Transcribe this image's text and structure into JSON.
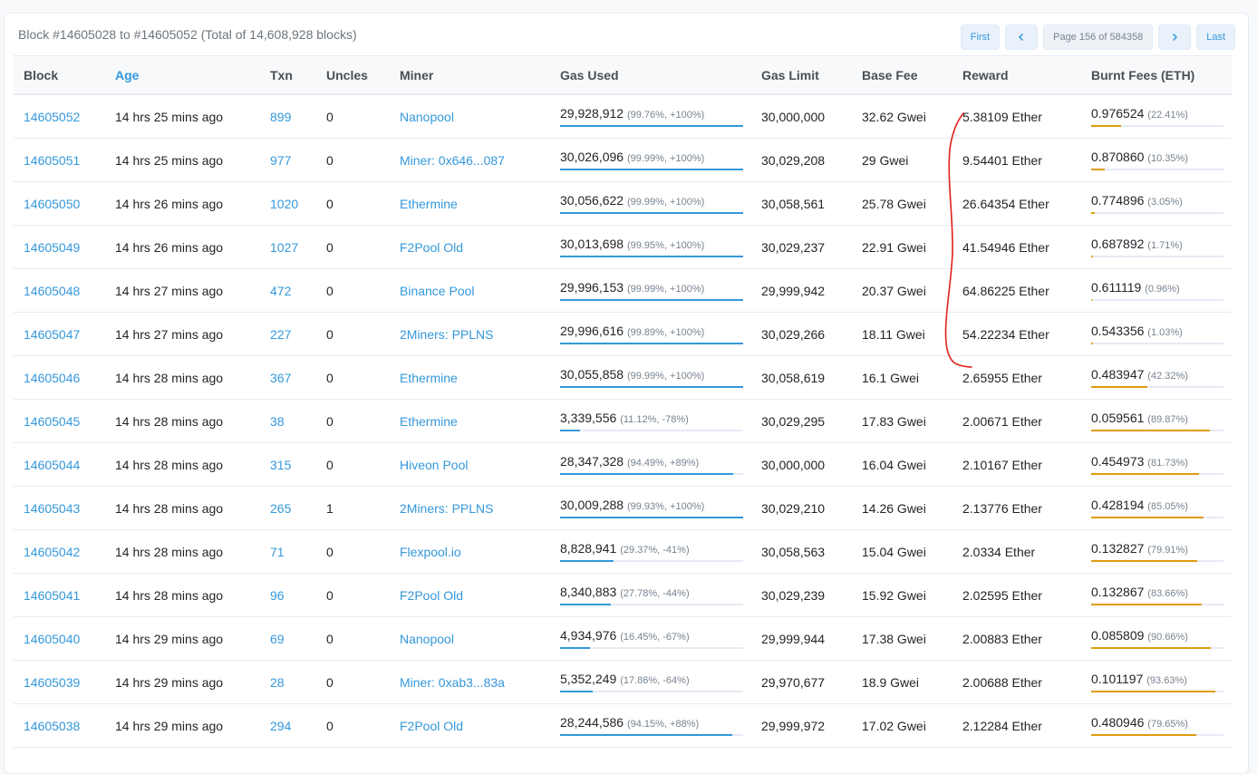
{
  "summary": "Block #14605028 to #14605052 (Total of 14,608,928 blocks)",
  "pagination": {
    "first": "First",
    "prev_icon": "chevron-left",
    "page_info": "Page 156 of 584358",
    "next_icon": "chevron-right",
    "last": "Last"
  },
  "columns": [
    "Block",
    "Age",
    "Txn",
    "Uncles",
    "Miner",
    "Gas Used",
    "Gas Limit",
    "Base Fee",
    "Reward",
    "Burnt Fees (ETH)"
  ],
  "colors": {
    "link": "#3498db",
    "gas_bar": "#3498db",
    "burn_bar": "#de9d0e",
    "annotation": "#e0201a"
  },
  "rows": [
    {
      "block": "14605052",
      "age": "14 hrs 25 mins ago",
      "txn": "899",
      "uncles": "0",
      "miner": "Nanopool",
      "gas_used": "29,928,912",
      "gas_detail": "(99.76%, +100%)",
      "gas_pct": 0.9976,
      "gas_limit": "30,000,000",
      "base_fee": "32.62 Gwei",
      "reward": "5.38109 Ether",
      "burnt": "0.976524",
      "burnt_pct_text": "(22.41%)",
      "burnt_pct": 0.2241
    },
    {
      "block": "14605051",
      "age": "14 hrs 25 mins ago",
      "txn": "977",
      "uncles": "0",
      "miner": "Miner: 0x646...087",
      "gas_used": "30,026,096",
      "gas_detail": "(99.99%, +100%)",
      "gas_pct": 0.9999,
      "gas_limit": "30,029,208",
      "base_fee": "29 Gwei",
      "reward": "9.54401 Ether",
      "burnt": "0.870860",
      "burnt_pct_text": "(10.35%)",
      "burnt_pct": 0.1035
    },
    {
      "block": "14605050",
      "age": "14 hrs 26 mins ago",
      "txn": "1020",
      "uncles": "0",
      "miner": "Ethermine",
      "gas_used": "30,056,622",
      "gas_detail": "(99.99%, +100%)",
      "gas_pct": 0.9999,
      "gas_limit": "30,058,561",
      "base_fee": "25.78 Gwei",
      "reward": "26.64354 Ether",
      "burnt": "0.774896",
      "burnt_pct_text": "(3.05%)",
      "burnt_pct": 0.0305
    },
    {
      "block": "14605049",
      "age": "14 hrs 26 mins ago",
      "txn": "1027",
      "uncles": "0",
      "miner": "F2Pool Old",
      "gas_used": "30,013,698",
      "gas_detail": "(99.95%, +100%)",
      "gas_pct": 0.9995,
      "gas_limit": "30,029,237",
      "base_fee": "22.91 Gwei",
      "reward": "41.54946 Ether",
      "burnt": "0.687892",
      "burnt_pct_text": "(1.71%)",
      "burnt_pct": 0.0171
    },
    {
      "block": "14605048",
      "age": "14 hrs 27 mins ago",
      "txn": "472",
      "uncles": "0",
      "miner": "Binance Pool",
      "gas_used": "29,996,153",
      "gas_detail": "(99.99%, +100%)",
      "gas_pct": 0.9999,
      "gas_limit": "29,999,942",
      "base_fee": "20.37 Gwei",
      "reward": "64.86225 Ether",
      "burnt": "0.611119",
      "burnt_pct_text": "(0.96%)",
      "burnt_pct": 0.0096
    },
    {
      "block": "14605047",
      "age": "14 hrs 27 mins ago",
      "txn": "227",
      "uncles": "0",
      "miner": "2Miners: PPLNS",
      "gas_used": "29,996,616",
      "gas_detail": "(99.89%, +100%)",
      "gas_pct": 0.9989,
      "gas_limit": "30,029,266",
      "base_fee": "18.11 Gwei",
      "reward": "54.22234 Ether",
      "burnt": "0.543356",
      "burnt_pct_text": "(1.03%)",
      "burnt_pct": 0.0103
    },
    {
      "block": "14605046",
      "age": "14 hrs 28 mins ago",
      "txn": "367",
      "uncles": "0",
      "miner": "Ethermine",
      "gas_used": "30,055,858",
      "gas_detail": "(99.99%, +100%)",
      "gas_pct": 0.9999,
      "gas_limit": "30,058,619",
      "base_fee": "16.1 Gwei",
      "reward": "2.65955 Ether",
      "burnt": "0.483947",
      "burnt_pct_text": "(42.32%)",
      "burnt_pct": 0.4232
    },
    {
      "block": "14605045",
      "age": "14 hrs 28 mins ago",
      "txn": "38",
      "uncles": "0",
      "miner": "Ethermine",
      "gas_used": "3,339,556",
      "gas_detail": "(11.12%, -78%)",
      "gas_pct": 0.1112,
      "gas_limit": "30,029,295",
      "base_fee": "17.83 Gwei",
      "reward": "2.00671 Ether",
      "burnt": "0.059561",
      "burnt_pct_text": "(89.87%)",
      "burnt_pct": 0.8987
    },
    {
      "block": "14605044",
      "age": "14 hrs 28 mins ago",
      "txn": "315",
      "uncles": "0",
      "miner": "Hiveon Pool",
      "gas_used": "28,347,328",
      "gas_detail": "(94.49%, +89%)",
      "gas_pct": 0.9449,
      "gas_limit": "30,000,000",
      "base_fee": "16.04 Gwei",
      "reward": "2.10167 Ether",
      "burnt": "0.454973",
      "burnt_pct_text": "(81.73%)",
      "burnt_pct": 0.8173
    },
    {
      "block": "14605043",
      "age": "14 hrs 28 mins ago",
      "txn": "265",
      "uncles": "1",
      "miner": "2Miners: PPLNS",
      "gas_used": "30,009,288",
      "gas_detail": "(99.93%, +100%)",
      "gas_pct": 0.9993,
      "gas_limit": "30,029,210",
      "base_fee": "14.26 Gwei",
      "reward": "2.13776 Ether",
      "burnt": "0.428194",
      "burnt_pct_text": "(85.05%)",
      "burnt_pct": 0.8505
    },
    {
      "block": "14605042",
      "age": "14 hrs 28 mins ago",
      "txn": "71",
      "uncles": "0",
      "miner": "Flexpool.io",
      "gas_used": "8,828,941",
      "gas_detail": "(29.37%, -41%)",
      "gas_pct": 0.2937,
      "gas_limit": "30,058,563",
      "base_fee": "15.04 Gwei",
      "reward": "2.0334 Ether",
      "burnt": "0.132827",
      "burnt_pct_text": "(79.91%)",
      "burnt_pct": 0.7991
    },
    {
      "block": "14605041",
      "age": "14 hrs 28 mins ago",
      "txn": "96",
      "uncles": "0",
      "miner": "F2Pool Old",
      "gas_used": "8,340,883",
      "gas_detail": "(27.78%, -44%)",
      "gas_pct": 0.2778,
      "gas_limit": "30,029,239",
      "base_fee": "15.92 Gwei",
      "reward": "2.02595 Ether",
      "burnt": "0.132867",
      "burnt_pct_text": "(83.66%)",
      "burnt_pct": 0.8366
    },
    {
      "block": "14605040",
      "age": "14 hrs 29 mins ago",
      "txn": "69",
      "uncles": "0",
      "miner": "Nanopool",
      "gas_used": "4,934,976",
      "gas_detail": "(16.45%, -67%)",
      "gas_pct": 0.1645,
      "gas_limit": "29,999,944",
      "base_fee": "17.38 Gwei",
      "reward": "2.00883 Ether",
      "burnt": "0.085809",
      "burnt_pct_text": "(90.66%)",
      "burnt_pct": 0.9066
    },
    {
      "block": "14605039",
      "age": "14 hrs 29 mins ago",
      "txn": "28",
      "uncles": "0",
      "miner": "Miner: 0xab3...83a",
      "gas_used": "5,352,249",
      "gas_detail": "(17.86%, -64%)",
      "gas_pct": 0.1786,
      "gas_limit": "29,970,677",
      "base_fee": "18.9 Gwei",
      "reward": "2.00688 Ether",
      "burnt": "0.101197",
      "burnt_pct_text": "(93.63%)",
      "burnt_pct": 0.9363
    },
    {
      "block": "14605038",
      "age": "14 hrs 29 mins ago",
      "txn": "294",
      "uncles": "0",
      "miner": "F2Pool Old",
      "gas_used": "28,244,586",
      "gas_detail": "(94.15%, +88%)",
      "gas_pct": 0.9415,
      "gas_limit": "29,999,972",
      "base_fee": "17.02 Gwei",
      "reward": "2.12284 Ether",
      "burnt": "0.480946",
      "burnt_pct_text": "(79.65%)",
      "burnt_pct": 0.7965
    }
  ]
}
